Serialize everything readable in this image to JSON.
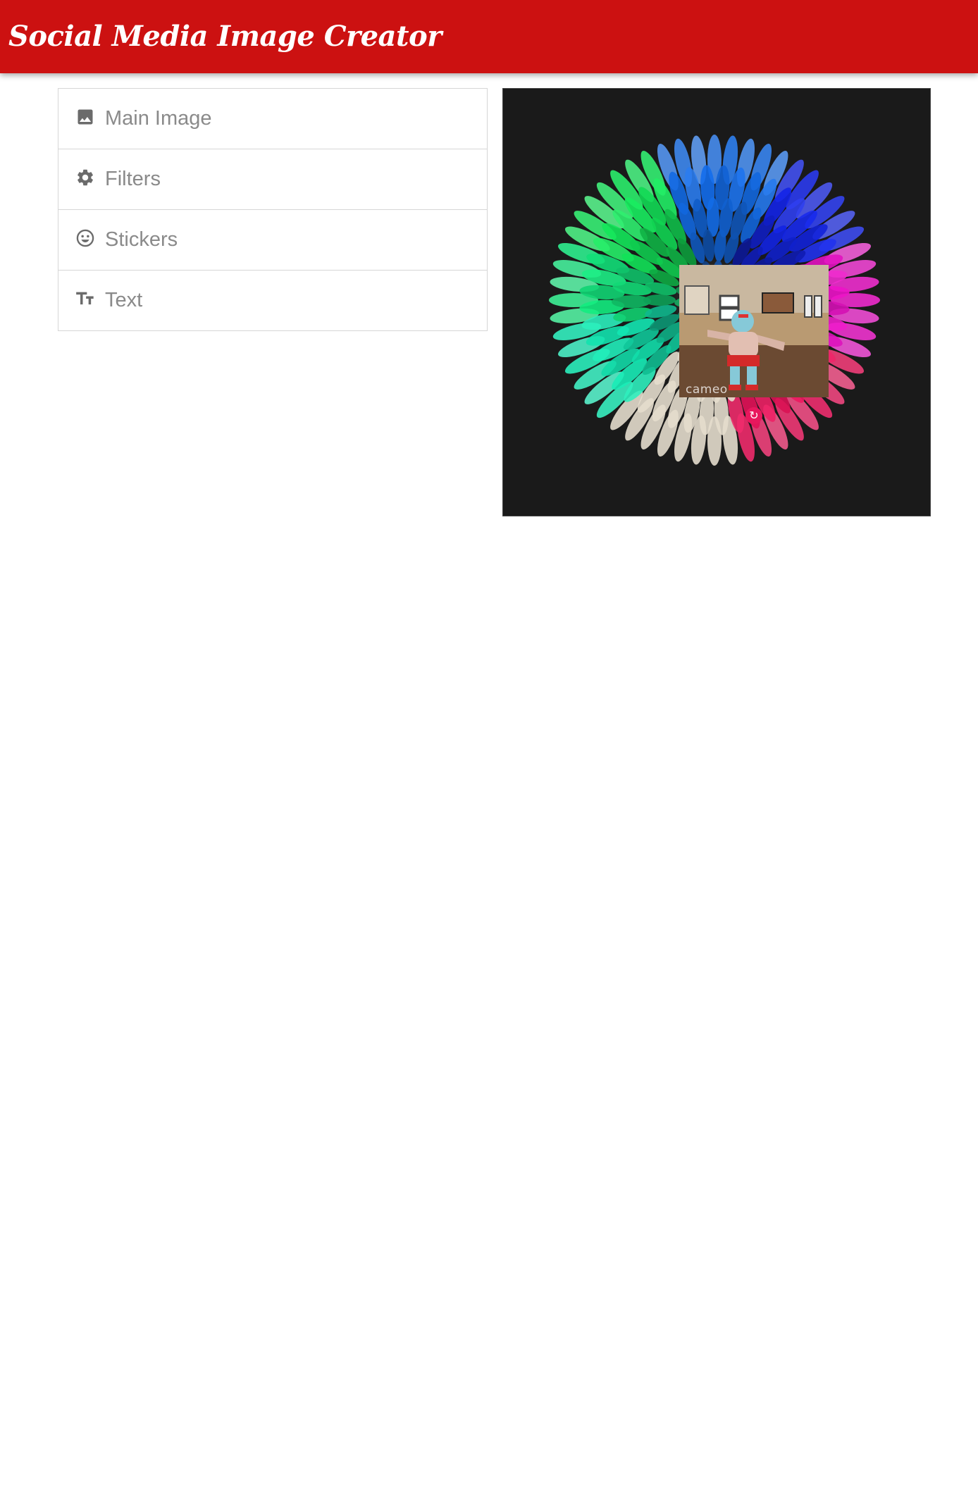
{
  "app": {
    "title": "Social Media Image Creator",
    "brand_color": "#cc1111"
  },
  "menu": {
    "items": [
      {
        "label": "Main Image",
        "icon": "image-icon"
      },
      {
        "label": "Filters",
        "icon": "gear-icon"
      },
      {
        "label": "Stickers",
        "icon": "smiley-icon"
      },
      {
        "label": "Text",
        "icon": "text-size-icon"
      }
    ]
  },
  "canvas": {
    "background": "#1a1a1a",
    "main_image": "colorful-flower",
    "sticker": {
      "caption": "cameo",
      "rotate_icon": "↻",
      "handle_color": "#e8175d"
    }
  }
}
